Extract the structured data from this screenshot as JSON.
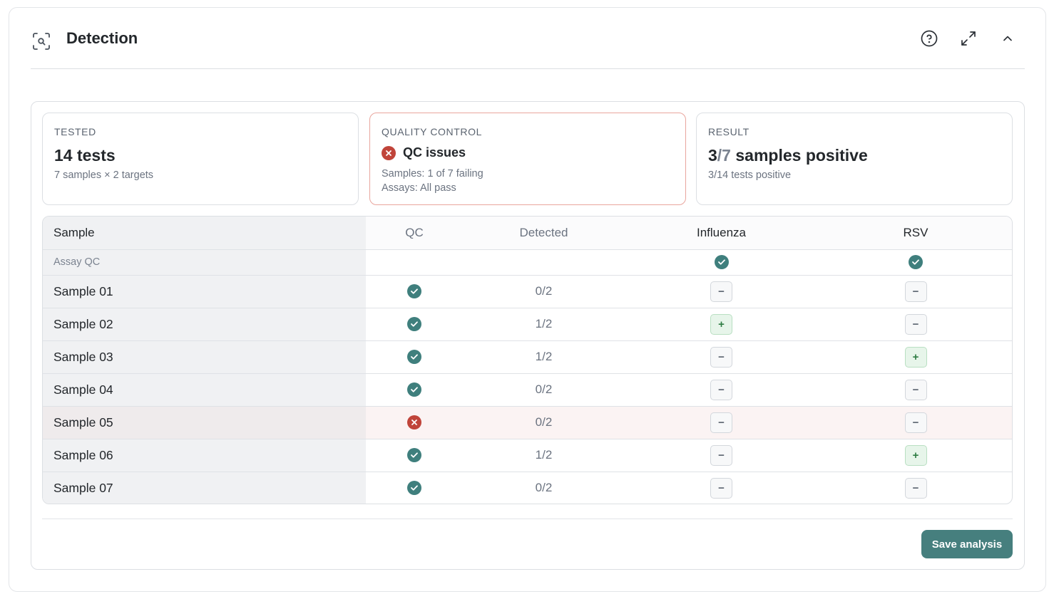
{
  "header": {
    "title": "Detection",
    "icons": [
      "scan-search-icon",
      "help-icon",
      "expand-icon",
      "chevron-up-icon"
    ]
  },
  "summary": {
    "tested": {
      "label": "TESTED",
      "value": "14 tests",
      "sub": "7 samples × 2 targets"
    },
    "quality_control": {
      "label": "QUALITY CONTROL",
      "status": "QC issues",
      "samples": "Samples: 1 of 7 failing",
      "assays": "Assays: All pass"
    },
    "result": {
      "label": "RESULT",
      "positive": "3",
      "total": "/7",
      "suffix": " samples positive",
      "sub": "3/14 tests positive"
    }
  },
  "table": {
    "columns": [
      "Sample",
      "QC",
      "Detected",
      "Influenza",
      "RSV"
    ],
    "assay_row": {
      "label": "Assay QC",
      "influenza": "pass",
      "rsv": "pass"
    },
    "rows": [
      {
        "sample": "Sample 01",
        "qc": "pass",
        "detected": "0/2",
        "influenza": "−",
        "rsv": "−"
      },
      {
        "sample": "Sample 02",
        "qc": "pass",
        "detected": "1/2",
        "influenza": "+",
        "rsv": "−"
      },
      {
        "sample": "Sample 03",
        "qc": "pass",
        "detected": "1/2",
        "influenza": "−",
        "rsv": "+"
      },
      {
        "sample": "Sample 04",
        "qc": "pass",
        "detected": "0/2",
        "influenza": "−",
        "rsv": "−"
      },
      {
        "sample": "Sample 05",
        "qc": "fail",
        "detected": "0/2",
        "influenza": "−",
        "rsv": "−"
      },
      {
        "sample": "Sample 06",
        "qc": "pass",
        "detected": "1/2",
        "influenza": "−",
        "rsv": "+"
      },
      {
        "sample": "Sample 07",
        "qc": "pass",
        "detected": "0/2",
        "influenza": "−",
        "rsv": "−"
      }
    ]
  },
  "footer": {
    "save_label": "Save analysis"
  },
  "colors": {
    "accent": "#467f7e",
    "pass": "#3f7f7d",
    "fail": "#c0443a",
    "positive_bg": "#e7f5ea"
  }
}
